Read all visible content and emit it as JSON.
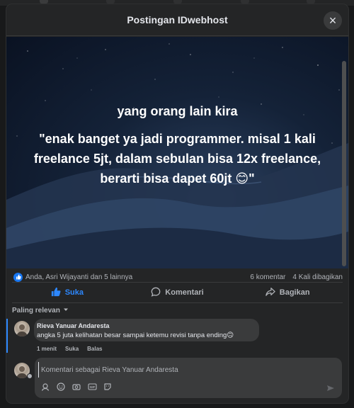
{
  "dialog": {
    "title": "Postingan IDwebhost",
    "close_label": "×"
  },
  "post": {
    "line1": "yang orang lain kira",
    "line2": "\"enak banget ya jadi programmer. misal 1 kali freelance 5jt, dalam sebulan bisa 12x freelance, berarti bisa dapet 60jt 😊\""
  },
  "reactions": {
    "summary": "Anda, Asri Wijayanti dan 5 lainnya",
    "comments": "6 komentar",
    "shares": "4 Kali dibagikan"
  },
  "actions": {
    "like": "Suka",
    "comment": "Komentari",
    "share": "Bagikan"
  },
  "sort": {
    "label": "Paling relevan"
  },
  "comment": {
    "author": "Rieva Yanuar Andaresta",
    "text": "angka 5 juta kelihatan besar sampai ketemu revisi tanpa ending🙃",
    "time": "1 menit",
    "like": "Suka",
    "reply": "Balas"
  },
  "composer": {
    "placeholder": "Komentari sebagai Rieva Yanuar Andaresta"
  },
  "colors": {
    "accent": "#2d88ff",
    "background": "#242526",
    "surface": "#3a3b3c"
  }
}
